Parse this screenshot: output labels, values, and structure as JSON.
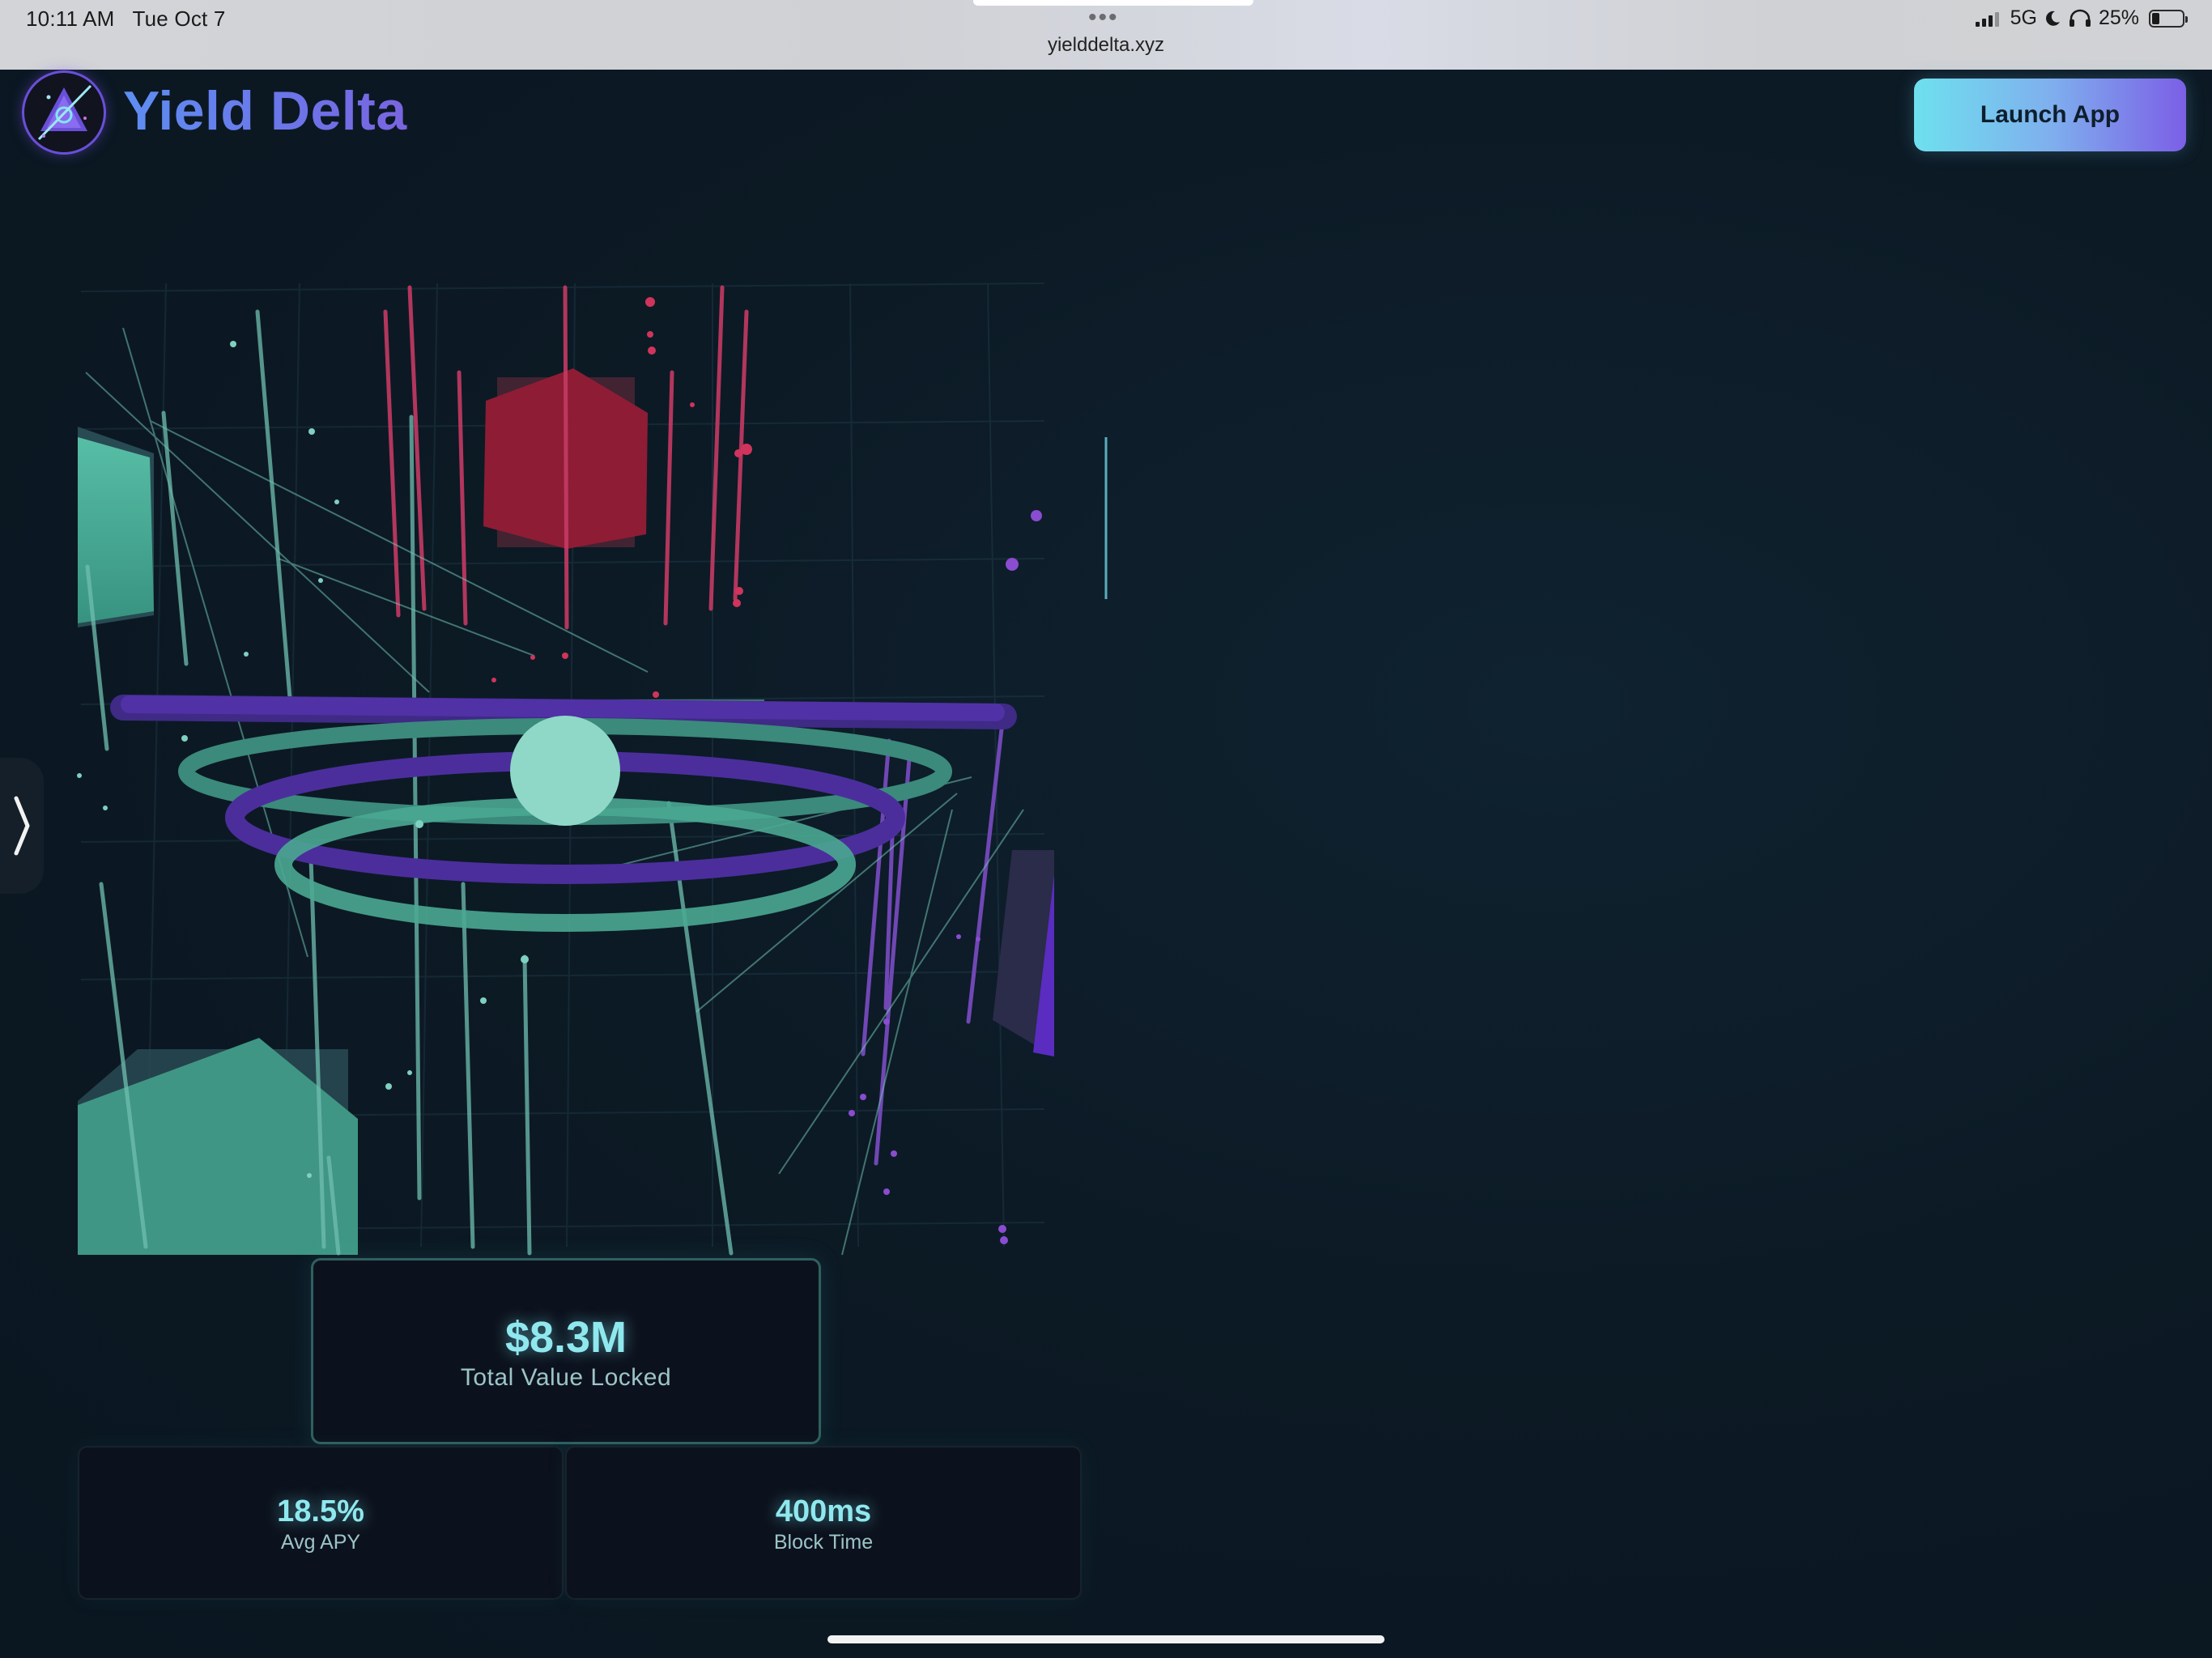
{
  "status_bar": {
    "time": "10:11 AM",
    "date": "Tue Oct 7",
    "url": "yielddelta.xyz",
    "network": "5G",
    "battery": "25%",
    "battery_level": 0.25
  },
  "header": {
    "brand": "Yield Delta",
    "launch_label": "Launch App"
  },
  "stats": {
    "tvl": {
      "value": "$8.3M",
      "label": "Total Value Locked"
    },
    "apy": {
      "value": "18.5%",
      "label": "Avg APY"
    },
    "block_time": {
      "value": "400ms",
      "label": "Block Time"
    }
  },
  "colors": {
    "teal": "#4fb8a0",
    "purple": "#5b2fb0",
    "red": "#c22a45",
    "accent_text": "#8fe8ee"
  },
  "icons": {
    "logo": "yield-delta-triangle-logo",
    "side_tab": "chevron-right-icon"
  }
}
